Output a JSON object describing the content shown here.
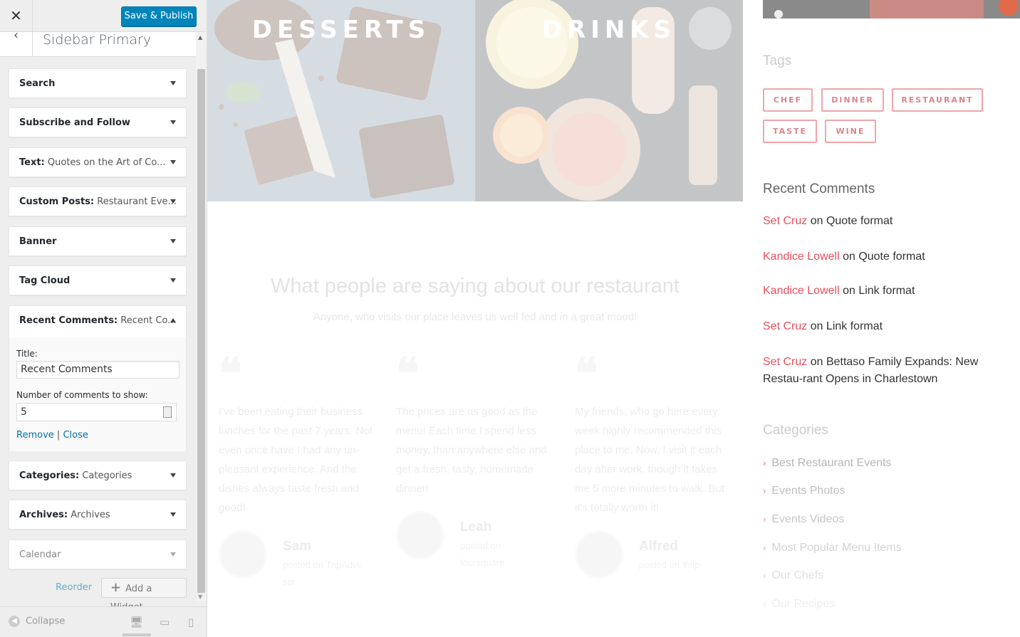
{
  "customizer": {
    "save_label": "Save & Publish",
    "section_title": "Sidebar Primary",
    "widgets": [
      {
        "title": "Search",
        "sub": ""
      },
      {
        "title": "Subscribe and Follow",
        "sub": ""
      },
      {
        "title": "Text:",
        "sub": " Quotes on the Art of Co..."
      },
      {
        "title": "Custom Posts:",
        "sub": " Restaurant Eve..."
      },
      {
        "title": "Banner",
        "sub": ""
      },
      {
        "title": "Tag Cloud",
        "sub": ""
      },
      {
        "title": "Recent Comments:",
        "sub": " Recent Co..."
      },
      {
        "title": "Categories:",
        "sub": " Categories"
      },
      {
        "title": "Archives:",
        "sub": " Archives"
      },
      {
        "title": "Calendar",
        "sub": ""
      }
    ],
    "recent_comments_form": {
      "title_label": "Title:",
      "title_value": "Recent Comments",
      "count_label": "Number of comments to show:",
      "count_value": "5",
      "remove_label": "Remove",
      "separator": "|",
      "close_label": "Close"
    },
    "reorder_label": "Reorder",
    "add_widget_label": "Add a Widget",
    "collapse_label": "Collapse"
  },
  "preview": {
    "banners": [
      {
        "label": "DESSERTS"
      },
      {
        "label": "DRINKS"
      }
    ],
    "testimonials": {
      "title": "What people are saying about our restaurant",
      "subtitle": "Anyone, who visits our place leaves us well fed and in a great mood!",
      "items": [
        {
          "text": "I've been eating their business lunches for the past 7 years. Not even once have I had any un-pleasant experience. And the dishes always taste fresh and good!",
          "name": "Sam",
          "source": "posted on TripAdvi-sor"
        },
        {
          "text": "The prices are as good as the menu! Each time I spend less money, than anywhere else and get a fresh, tasty, homemade dinner!",
          "name": "Leah",
          "source": "posted on foursquare"
        },
        {
          "text": "My friends, who go here every week highly recommended this place to me. Now, I visit it each day after work, though it takes me 5 more minutes to walk. But it's totally worth it!",
          "name": "Alfred",
          "source": "posted on Yelp"
        }
      ]
    },
    "sidebar": {
      "tags_heading": "Tags",
      "tags": [
        "CHEF",
        "DINNER",
        "RESTAURANT",
        "TASTE",
        "WINE"
      ],
      "recent_comments_heading": "Recent Comments",
      "comments": [
        {
          "author": "Set Cruz",
          "on": " on ",
          "post": "Quote format"
        },
        {
          "author": "Kandice Lowell",
          "on": " on ",
          "post": "Quote format"
        },
        {
          "author": "Kandice Lowell",
          "on": " on ",
          "post": "Link format"
        },
        {
          "author": "Set Cruz",
          "on": " on ",
          "post": "Link format"
        },
        {
          "author": "Set Cruz",
          "on": " on ",
          "post": "Bettaso Family Expands: New Restau-rant Opens in Charlestown"
        }
      ],
      "categories_heading": "Categories",
      "categories": [
        "Best Restaurant Events",
        "Events Photos",
        "Events Videos",
        "Most Popular Menu Items",
        "Our Chefs",
        "Our Recipes"
      ]
    }
  }
}
